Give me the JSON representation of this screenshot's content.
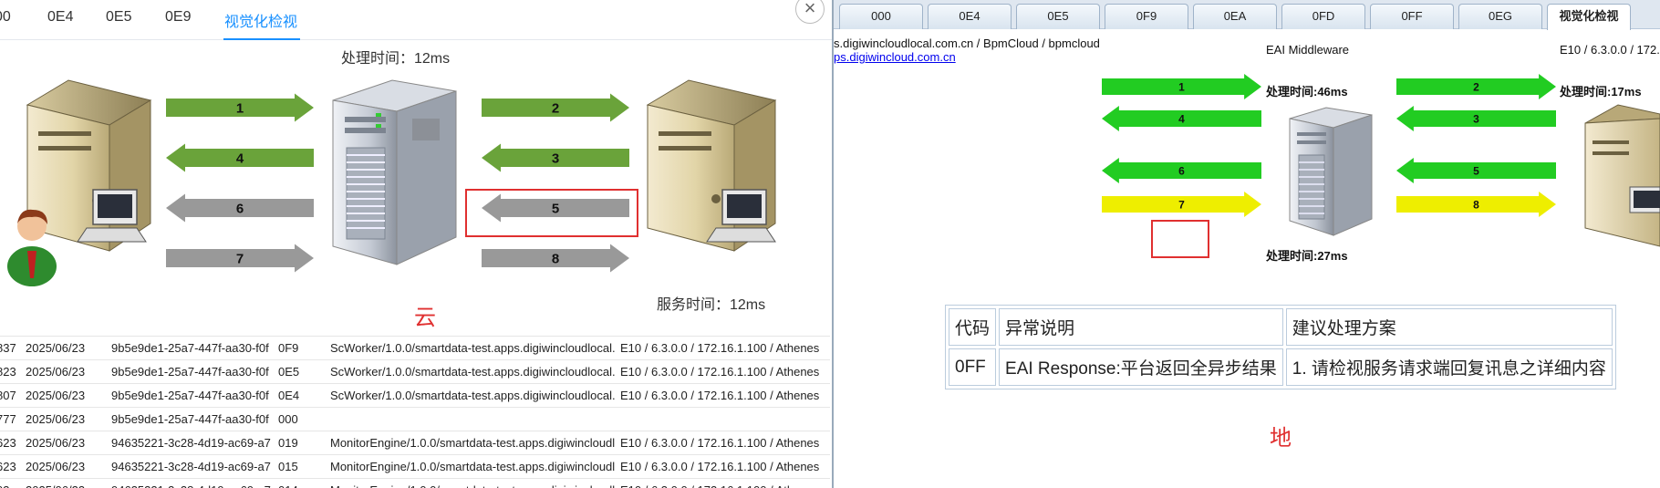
{
  "left_panel": {
    "tabs": [
      {
        "label": "00"
      },
      {
        "label": "0E4"
      },
      {
        "label": "0E5"
      },
      {
        "label": "0E9"
      },
      {
        "label": "视觉化检视",
        "active": true
      }
    ],
    "close_glyph": "×",
    "process_time": "处理时间：12ms",
    "service_time": "服务时间：12ms",
    "cloud_label": "云",
    "arrows": [
      {
        "label": "1",
        "color": "#6aa33a"
      },
      {
        "label": "2",
        "color": "#6aa33a"
      },
      {
        "label": "3",
        "color": "#6aa33a"
      },
      {
        "label": "4",
        "color": "#6aa33a"
      },
      {
        "label": "5",
        "color": "#999999"
      },
      {
        "label": "6",
        "color": "#999999"
      },
      {
        "label": "7",
        "color": "#999999"
      },
      {
        "label": "8",
        "color": "#999999"
      }
    ],
    "log_rows": [
      {
        "id": "837",
        "date": "2025/06/23",
        "uuid": "9b5e9de1-25a7-447f-aa30-f0f",
        "code": "0F9",
        "caller": "ScWorker/1.0.0/smartdata-test.apps.digiwincloudlocal.",
        "target": "E10 / 6.3.0.0 / 172.16.1.100 / Athenes"
      },
      {
        "id": "823",
        "date": "2025/06/23",
        "uuid": "9b5e9de1-25a7-447f-aa30-f0f",
        "code": "0E5",
        "caller": "ScWorker/1.0.0/smartdata-test.apps.digiwincloudlocal.",
        "target": "E10 / 6.3.0.0 / 172.16.1.100 / Athenes"
      },
      {
        "id": "807",
        "date": "2025/06/23",
        "uuid": "9b5e9de1-25a7-447f-aa30-f0f",
        "code": "0E4",
        "caller": "ScWorker/1.0.0/smartdata-test.apps.digiwincloudlocal.",
        "target": "E10 / 6.3.0.0 / 172.16.1.100 / Athenes"
      },
      {
        "id": "777",
        "date": "2025/06/23",
        "uuid": "9b5e9de1-25a7-447f-aa30-f0f",
        "code": "000",
        "caller": "",
        "target": ""
      },
      {
        "id": "623",
        "date": "2025/06/23",
        "uuid": "94635221-3c28-4d19-ac69-a7",
        "code": "019",
        "caller": "MonitorEngine/1.0.0/smartdata-test.apps.digiwincloudl",
        "target": "E10 / 6.3.0.0 / 172.16.1.100 / Athenes"
      },
      {
        "id": "623",
        "date": "2025/06/23",
        "uuid": "94635221-3c28-4d19-ac69-a7",
        "code": "015",
        "caller": "MonitorEngine/1.0.0/smartdata-test.apps.digiwincloudl",
        "target": "E10 / 6.3.0.0 / 172.16.1.100 / Athenes"
      },
      {
        "id": "03",
        "date": "2025/06/23",
        "uuid": "94635221-3c28-4d19-ac69-a7",
        "code": "014",
        "caller": "MonitorEngine/1.0.0/smartdata-test.apps.digiwincloudl",
        "target": "E10 / 6.3.0.0 / 172.16.1.100 / Athenes"
      }
    ]
  },
  "right_panel": {
    "tabs": [
      {
        "label": "000"
      },
      {
        "label": "0E4"
      },
      {
        "label": "0E5"
      },
      {
        "label": "0F9"
      },
      {
        "label": "0EA"
      },
      {
        "label": "0FD"
      },
      {
        "label": "0FF"
      },
      {
        "label": "0EG"
      },
      {
        "label": "视觉化检视",
        "active": true
      }
    ],
    "source_path": "s.digiwincloudlocal.com.cn / BpmCloud / bpmcloud",
    "source_link": "ps.digiwincloud.com.cn",
    "middleware_title": "EAI Middleware",
    "target_info": "E10 / 6.3.0.0 / 172.",
    "time_left_top": "处理时间:46ms",
    "time_right_top": "处理时间:17ms",
    "time_left_bottom": "处理时间:27ms",
    "arrows": [
      {
        "label": "1",
        "color": "#22cc22"
      },
      {
        "label": "2",
        "color": "#22cc22"
      },
      {
        "label": "3",
        "color": "#22cc22"
      },
      {
        "label": "4",
        "color": "#22cc22"
      },
      {
        "label": "5",
        "color": "#22cc22"
      },
      {
        "label": "6",
        "color": "#22cc22"
      },
      {
        "label": "7",
        "color": "#eeee00"
      },
      {
        "label": "8",
        "color": "#eeee00"
      }
    ],
    "error_table": {
      "headers": [
        "代码",
        "异常说明",
        "建议处理方案"
      ],
      "row": [
        "0FF",
        "EAI Response:平台返回全异步结果",
        "1. 请检视服务请求端回复讯息之详细内容"
      ]
    },
    "land_label": "地"
  }
}
